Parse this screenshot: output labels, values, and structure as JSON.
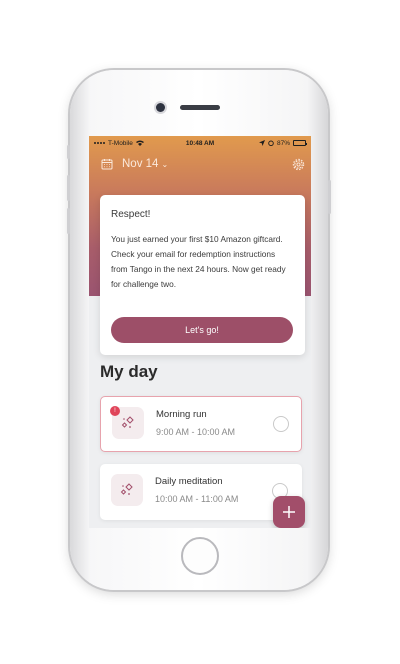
{
  "status_bar": {
    "carrier": "T-Mobile",
    "time": "10:48 AM",
    "battery": "87%",
    "battery_level": 0.87
  },
  "header": {
    "date": "Nov 14",
    "date_chevron": "⌄"
  },
  "notice": {
    "title": "Respect!",
    "body": "You just earned your first $10 Amazon giftcard. Check your email for redemption instructions from Tango in the next 24 hours. Now get ready for challenge two.",
    "button": "Let's go!"
  },
  "section": {
    "title": "My day"
  },
  "tasks": [
    {
      "name": "Morning run",
      "time": "9:00 AM - 10:00 AM",
      "badge": "!"
    },
    {
      "name": "Daily meditation",
      "time": "10:00 AM - 11:00 AM"
    }
  ],
  "fab": {
    "label": "+"
  },
  "colors": {
    "accent": "#9d4f68",
    "header_top": "#e19a4d",
    "header_bottom": "#9a5470",
    "badge": "#e0455a"
  }
}
